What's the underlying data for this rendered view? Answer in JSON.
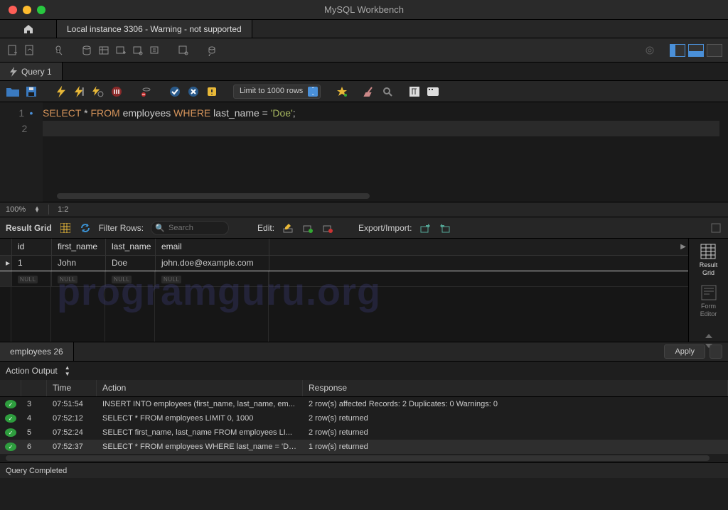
{
  "window": {
    "title": "MySQL Workbench"
  },
  "connection_tab": "Local instance 3306 - Warning - not supported",
  "query_tab": "Query 1",
  "limit_select": "Limit to 1000 rows",
  "sql_line1": {
    "select": "SELECT",
    "star": "*",
    "from": "FROM",
    "table": "employees",
    "where": "WHERE",
    "col": "last_name",
    "eq": "=",
    "val": "'Doe'",
    "semi": ";"
  },
  "editor_status": {
    "zoom": "100%",
    "pos": "1:2"
  },
  "result_toolbar": {
    "label": "Result Grid",
    "filter_label": "Filter Rows:",
    "filter_placeholder": "Search",
    "edit_label": "Edit:",
    "export_label": "Export/Import:"
  },
  "grid": {
    "headers": {
      "id": "id",
      "first_name": "first_name",
      "last_name": "last_name",
      "email": "email"
    },
    "row": {
      "id": "1",
      "first_name": "John",
      "last_name": "Doe",
      "email": "john.doe@example.com"
    },
    "null": "NULL"
  },
  "grid_side": {
    "result_grid": "Result\nGrid",
    "form_editor": "Form\nEditor"
  },
  "result_tab": "employees 26",
  "apply": "Apply",
  "action_output_label": "Action Output",
  "action_headers": {
    "time": "Time",
    "action": "Action",
    "response": "Response"
  },
  "actions": [
    {
      "idx": "3",
      "time": "07:51:54",
      "action": "INSERT INTO employees (first_name, last_name, em...",
      "response": "2 row(s) affected Records: 2  Duplicates: 0  Warnings: 0"
    },
    {
      "idx": "4",
      "time": "07:52:12",
      "action": "SELECT * FROM employees LIMIT 0, 1000",
      "response": "2 row(s) returned"
    },
    {
      "idx": "5",
      "time": "07:52:24",
      "action": "SELECT first_name, last_name FROM employees LI...",
      "response": "2 row(s) returned"
    },
    {
      "idx": "6",
      "time": "07:52:37",
      "action": "SELECT * FROM employees WHERE last_name = 'Do...",
      "response": "1 row(s) returned"
    }
  ],
  "statusbar": "Query Completed",
  "watermark": "programguru.org"
}
